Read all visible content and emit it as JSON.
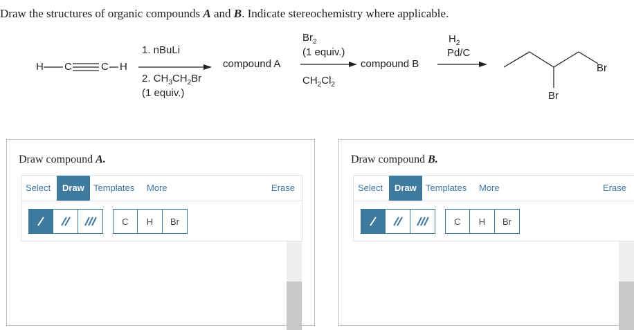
{
  "question": {
    "prefix": "Draw the structures of organic compounds ",
    "a": "A",
    "and": " and ",
    "b": "B",
    "suffix": ". Indicate stereochemistry where applicable."
  },
  "scheme": {
    "reactant_h1": "H",
    "reactant_c1": "C",
    "reactant_c2": "C",
    "reactant_h2": "H",
    "step1_reagent1": "1. nBuLi",
    "step1_reagent2_prefix": "2. CH",
    "step1_reagent2_s1": "3",
    "step1_reagent2_mid": "CH",
    "step1_reagent2_s2": "2",
    "step1_reagent2_suffix": "Br",
    "step1_reagent3": "(1 equiv.)",
    "compound_a": "compound A",
    "step2_br": "Br",
    "step2_br_sub": "2",
    "step2_equiv": "(1 equiv.)",
    "step2_solvent_prefix": "CH",
    "step2_solvent_s1": "2",
    "step2_solvent_mid": "Cl",
    "step2_solvent_s2": "2",
    "compound_b": "compound B",
    "step3_h": "H",
    "step3_h_sub": "2",
    "step3_cat": "Pd/C",
    "product_br1": "Br",
    "product_br2": "Br"
  },
  "panels": [
    {
      "title_prefix": "Draw compound ",
      "title_letter": "A.",
      "tabs": {
        "select": "Select",
        "draw": "Draw",
        "templates": "Templates",
        "more": "More",
        "erase": "Erase"
      },
      "atoms": [
        "C",
        "H",
        "Br"
      ]
    },
    {
      "title_prefix": "Draw compound ",
      "title_letter": "B.",
      "tabs": {
        "select": "Select",
        "draw": "Draw",
        "templates": "Templates",
        "more": "More",
        "erase": "Erase"
      },
      "atoms": [
        "C",
        "H",
        "Br"
      ]
    }
  ],
  "colors": {
    "accent": "#3d7a9e",
    "link": "#3b78a0",
    "border": "#bdbdbd"
  }
}
